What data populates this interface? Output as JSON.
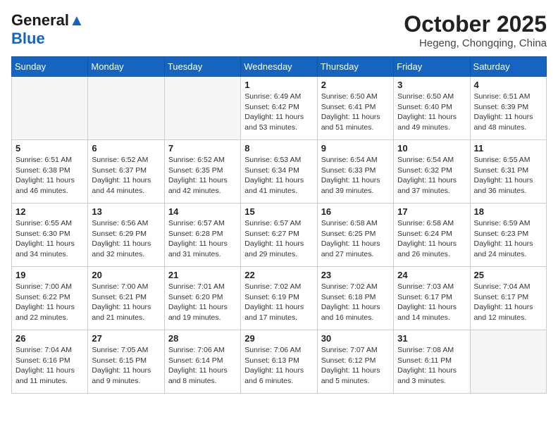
{
  "header": {
    "logo_line1": "General",
    "logo_line2": "Blue",
    "month": "October 2025",
    "location": "Hegeng, Chongqing, China"
  },
  "days_of_week": [
    "Sunday",
    "Monday",
    "Tuesday",
    "Wednesday",
    "Thursday",
    "Friday",
    "Saturday"
  ],
  "weeks": [
    [
      {
        "day": "",
        "info": ""
      },
      {
        "day": "",
        "info": ""
      },
      {
        "day": "",
        "info": ""
      },
      {
        "day": "1",
        "info": "Sunrise: 6:49 AM\nSunset: 6:42 PM\nDaylight: 11 hours\nand 53 minutes."
      },
      {
        "day": "2",
        "info": "Sunrise: 6:50 AM\nSunset: 6:41 PM\nDaylight: 11 hours\nand 51 minutes."
      },
      {
        "day": "3",
        "info": "Sunrise: 6:50 AM\nSunset: 6:40 PM\nDaylight: 11 hours\nand 49 minutes."
      },
      {
        "day": "4",
        "info": "Sunrise: 6:51 AM\nSunset: 6:39 PM\nDaylight: 11 hours\nand 48 minutes."
      }
    ],
    [
      {
        "day": "5",
        "info": "Sunrise: 6:51 AM\nSunset: 6:38 PM\nDaylight: 11 hours\nand 46 minutes."
      },
      {
        "day": "6",
        "info": "Sunrise: 6:52 AM\nSunset: 6:37 PM\nDaylight: 11 hours\nand 44 minutes."
      },
      {
        "day": "7",
        "info": "Sunrise: 6:52 AM\nSunset: 6:35 PM\nDaylight: 11 hours\nand 42 minutes."
      },
      {
        "day": "8",
        "info": "Sunrise: 6:53 AM\nSunset: 6:34 PM\nDaylight: 11 hours\nand 41 minutes."
      },
      {
        "day": "9",
        "info": "Sunrise: 6:54 AM\nSunset: 6:33 PM\nDaylight: 11 hours\nand 39 minutes."
      },
      {
        "day": "10",
        "info": "Sunrise: 6:54 AM\nSunset: 6:32 PM\nDaylight: 11 hours\nand 37 minutes."
      },
      {
        "day": "11",
        "info": "Sunrise: 6:55 AM\nSunset: 6:31 PM\nDaylight: 11 hours\nand 36 minutes."
      }
    ],
    [
      {
        "day": "12",
        "info": "Sunrise: 6:55 AM\nSunset: 6:30 PM\nDaylight: 11 hours\nand 34 minutes."
      },
      {
        "day": "13",
        "info": "Sunrise: 6:56 AM\nSunset: 6:29 PM\nDaylight: 11 hours\nand 32 minutes."
      },
      {
        "day": "14",
        "info": "Sunrise: 6:57 AM\nSunset: 6:28 PM\nDaylight: 11 hours\nand 31 minutes."
      },
      {
        "day": "15",
        "info": "Sunrise: 6:57 AM\nSunset: 6:27 PM\nDaylight: 11 hours\nand 29 minutes."
      },
      {
        "day": "16",
        "info": "Sunrise: 6:58 AM\nSunset: 6:25 PM\nDaylight: 11 hours\nand 27 minutes."
      },
      {
        "day": "17",
        "info": "Sunrise: 6:58 AM\nSunset: 6:24 PM\nDaylight: 11 hours\nand 26 minutes."
      },
      {
        "day": "18",
        "info": "Sunrise: 6:59 AM\nSunset: 6:23 PM\nDaylight: 11 hours\nand 24 minutes."
      }
    ],
    [
      {
        "day": "19",
        "info": "Sunrise: 7:00 AM\nSunset: 6:22 PM\nDaylight: 11 hours\nand 22 minutes."
      },
      {
        "day": "20",
        "info": "Sunrise: 7:00 AM\nSunset: 6:21 PM\nDaylight: 11 hours\nand 21 minutes."
      },
      {
        "day": "21",
        "info": "Sunrise: 7:01 AM\nSunset: 6:20 PM\nDaylight: 11 hours\nand 19 minutes."
      },
      {
        "day": "22",
        "info": "Sunrise: 7:02 AM\nSunset: 6:19 PM\nDaylight: 11 hours\nand 17 minutes."
      },
      {
        "day": "23",
        "info": "Sunrise: 7:02 AM\nSunset: 6:18 PM\nDaylight: 11 hours\nand 16 minutes."
      },
      {
        "day": "24",
        "info": "Sunrise: 7:03 AM\nSunset: 6:17 PM\nDaylight: 11 hours\nand 14 minutes."
      },
      {
        "day": "25",
        "info": "Sunrise: 7:04 AM\nSunset: 6:17 PM\nDaylight: 11 hours\nand 12 minutes."
      }
    ],
    [
      {
        "day": "26",
        "info": "Sunrise: 7:04 AM\nSunset: 6:16 PM\nDaylight: 11 hours\nand 11 minutes."
      },
      {
        "day": "27",
        "info": "Sunrise: 7:05 AM\nSunset: 6:15 PM\nDaylight: 11 hours\nand 9 minutes."
      },
      {
        "day": "28",
        "info": "Sunrise: 7:06 AM\nSunset: 6:14 PM\nDaylight: 11 hours\nand 8 minutes."
      },
      {
        "day": "29",
        "info": "Sunrise: 7:06 AM\nSunset: 6:13 PM\nDaylight: 11 hours\nand 6 minutes."
      },
      {
        "day": "30",
        "info": "Sunrise: 7:07 AM\nSunset: 6:12 PM\nDaylight: 11 hours\nand 5 minutes."
      },
      {
        "day": "31",
        "info": "Sunrise: 7:08 AM\nSunset: 6:11 PM\nDaylight: 11 hours\nand 3 minutes."
      },
      {
        "day": "",
        "info": ""
      }
    ]
  ]
}
